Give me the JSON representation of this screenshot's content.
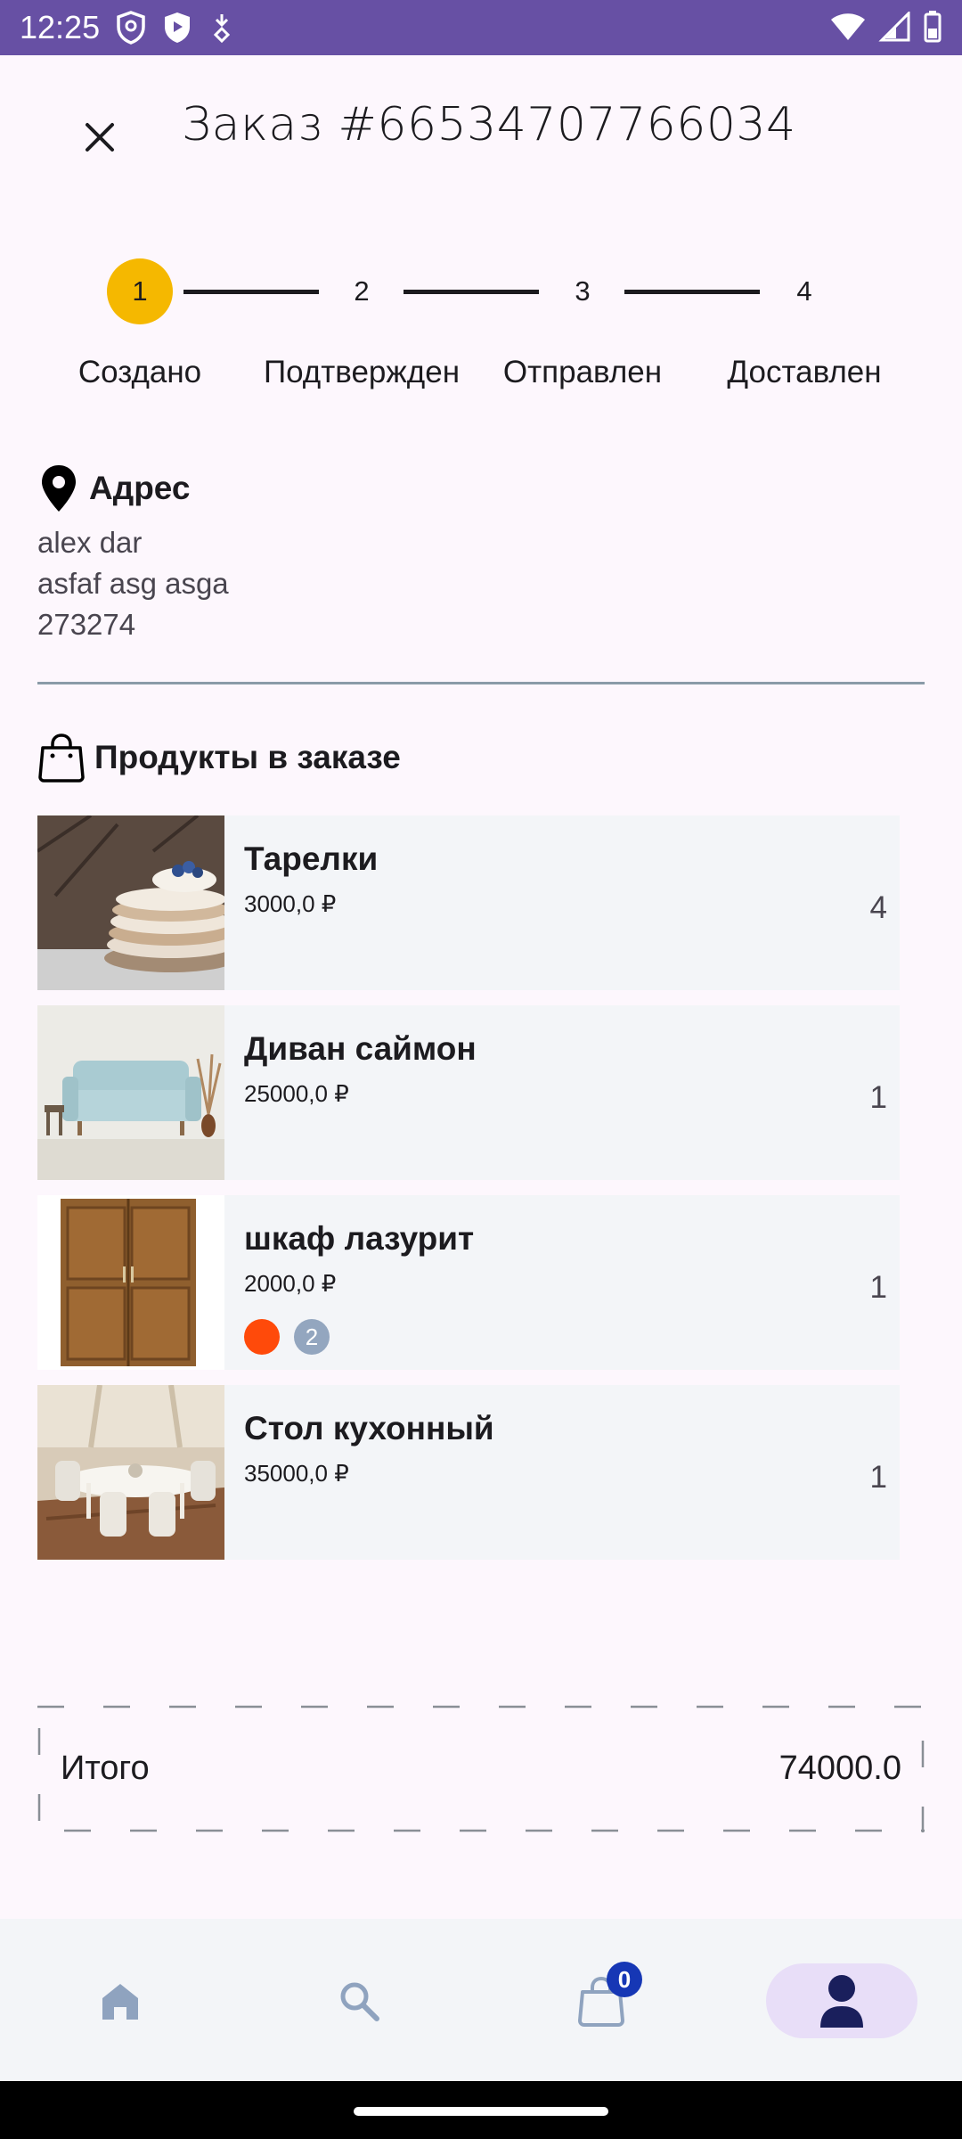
{
  "status_bar": {
    "time": "12:25"
  },
  "header": {
    "title": "Заказ #66534707766034"
  },
  "stepper": {
    "steps": [
      {
        "number": "1",
        "label": "Создано",
        "active": true
      },
      {
        "number": "2",
        "label": "Подтвержден",
        "active": false
      },
      {
        "number": "3",
        "label": "Отправлен",
        "active": false
      },
      {
        "number": "4",
        "label": "Доставлен",
        "active": false
      }
    ]
  },
  "address": {
    "title": "Адрес",
    "lines": [
      "alex dar",
      "asfaf asg asga",
      "273274"
    ]
  },
  "products": {
    "title": "Продукты в заказе",
    "items": [
      {
        "name": "Тарелки",
        "price": "3000,0 ₽",
        "qty": "4",
        "image": "plates-photo"
      },
      {
        "name": "Диван саймон",
        "price": "25000,0 ₽",
        "qty": "1",
        "image": "sofa-photo"
      },
      {
        "name": "шкаф лазурит",
        "price": "2000,0 ₽",
        "qty": "1",
        "image": "wardrobe-photo",
        "color_hex": "#ff4a0a",
        "extra_colors": "2"
      },
      {
        "name": "Стол кухонный",
        "price": "35000,0 ₽",
        "qty": "1",
        "image": "kitchen-table-photo"
      }
    ]
  },
  "total": {
    "label": "Итого",
    "value": "74000.0"
  },
  "nav": {
    "items": [
      {
        "icon": "home-icon",
        "active": false
      },
      {
        "icon": "search-icon",
        "active": false
      },
      {
        "icon": "cart-icon",
        "active": false,
        "badge": "0"
      },
      {
        "icon": "profile-icon",
        "active": true
      }
    ]
  },
  "colors": {
    "status_bar": "#6750a4",
    "active_step": "#f5b800",
    "badge": "#1637b5",
    "nav_active_bg": "#e8def8"
  }
}
